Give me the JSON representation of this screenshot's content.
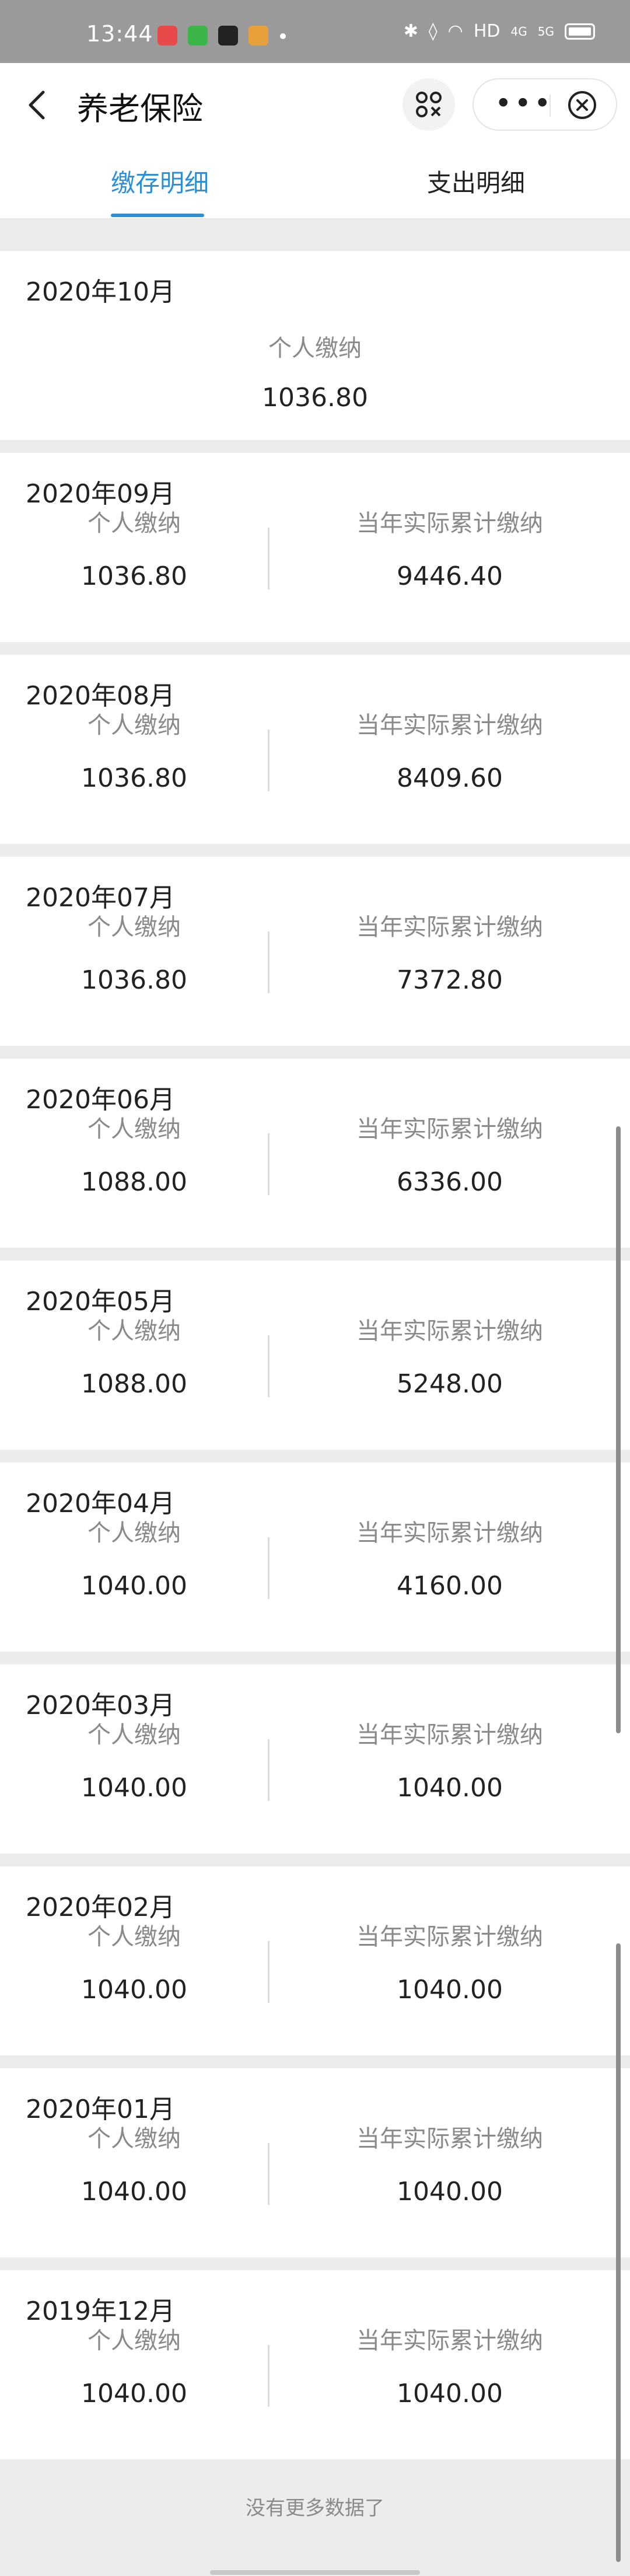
{
  "status_bar": {
    "time": "13:44",
    "network_label": "HD",
    "signal_labels": [
      "4G",
      "5G"
    ]
  },
  "header": {
    "title": "养老保险",
    "more_label": "•••"
  },
  "tabs": [
    {
      "label": "缴存明细",
      "active": true
    },
    {
      "label": "支出明细",
      "active": false
    }
  ],
  "accent_color": "#2d8fd5",
  "records": [
    {
      "month": "2020年10月",
      "personal_label": "个人缴纳",
      "personal": "1036.80"
    },
    {
      "month": "2020年09月",
      "personal_label": "个人缴纳",
      "personal": "1036.80",
      "cumulative_label": "当年实际累计缴纳",
      "cumulative": "9446.40"
    },
    {
      "month": "2020年08月",
      "personal_label": "个人缴纳",
      "personal": "1036.80",
      "cumulative_label": "当年实际累计缴纳",
      "cumulative": "8409.60"
    },
    {
      "month": "2020年07月",
      "personal_label": "个人缴纳",
      "personal": "1036.80",
      "cumulative_label": "当年实际累计缴纳",
      "cumulative": "7372.80"
    },
    {
      "month": "2020年06月",
      "personal_label": "个人缴纳",
      "personal": "1088.00",
      "cumulative_label": "当年实际累计缴纳",
      "cumulative": "6336.00"
    },
    {
      "month": "2020年05月",
      "personal_label": "个人缴纳",
      "personal": "1088.00",
      "cumulative_label": "当年实际累计缴纳",
      "cumulative": "5248.00"
    },
    {
      "month": "2020年04月",
      "personal_label": "个人缴纳",
      "personal": "1040.00",
      "cumulative_label": "当年实际累计缴纳",
      "cumulative": "4160.00"
    },
    {
      "month": "2020年03月",
      "personal_label": "个人缴纳",
      "personal": "1040.00",
      "cumulative_label": "当年实际累计缴纳",
      "cumulative": "1040.00"
    },
    {
      "month": "2020年02月",
      "personal_label": "个人缴纳",
      "personal": "1040.00",
      "cumulative_label": "当年实际累计缴纳",
      "cumulative": "1040.00"
    },
    {
      "month": "2020年01月",
      "personal_label": "个人缴纳",
      "personal": "1040.00",
      "cumulative_label": "当年实际累计缴纳",
      "cumulative": "1040.00"
    },
    {
      "month": "2019年12月",
      "personal_label": "个人缴纳",
      "personal": "1040.00",
      "cumulative_label": "当年实际累计缴纳",
      "cumulative": "1040.00"
    }
  ],
  "footer": {
    "no_more": "没有更多数据了"
  }
}
